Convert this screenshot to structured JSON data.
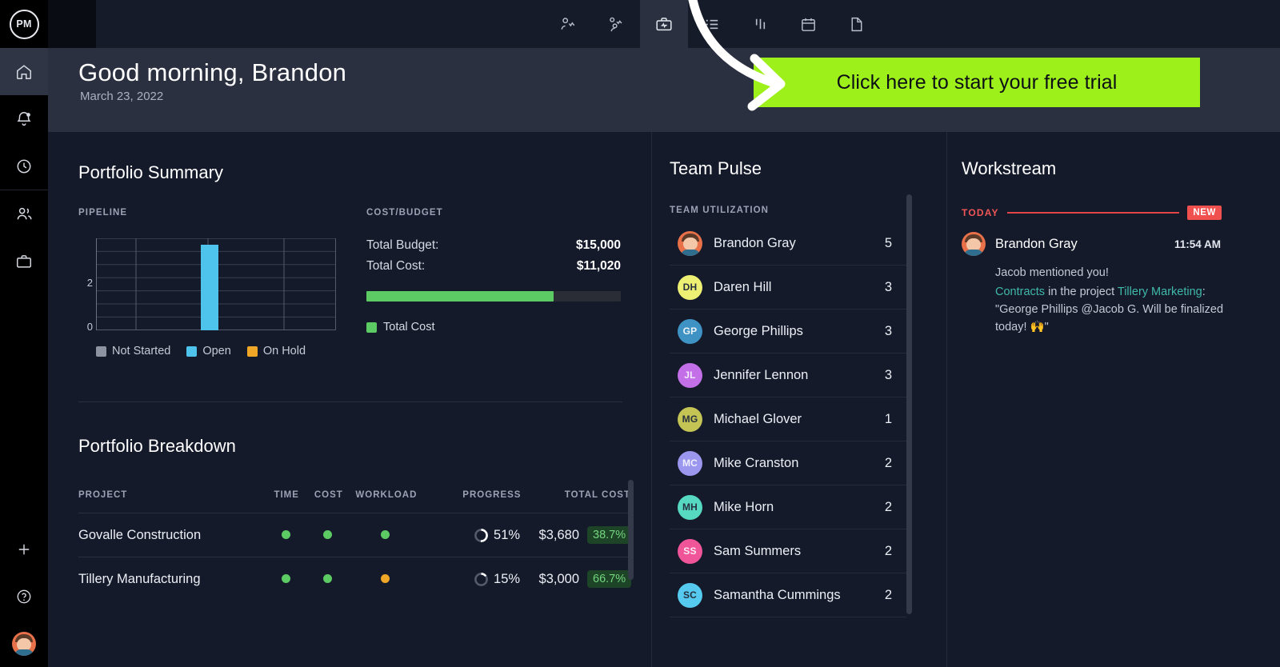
{
  "brand": {
    "logo_text": "PM"
  },
  "sidebar": {
    "items": [
      {
        "name": "home",
        "icon": "home-icon",
        "active": true
      },
      {
        "name": "notifications",
        "icon": "bell-icon",
        "active": false
      },
      {
        "name": "timesheets",
        "icon": "clock-icon",
        "active": false
      },
      {
        "name": "team",
        "icon": "people-icon",
        "active": false
      },
      {
        "name": "projects",
        "icon": "briefcase-icon",
        "active": false
      }
    ],
    "bottom_items": [
      {
        "name": "add",
        "icon": "plus-icon"
      },
      {
        "name": "help",
        "icon": "question-circle-icon"
      },
      {
        "name": "profile",
        "icon": "user-avatar"
      }
    ]
  },
  "topbar": {
    "tabs": [
      {
        "name": "my-work",
        "icon": "person-chart-icon",
        "active": false
      },
      {
        "name": "team-chart",
        "icon": "people-chart-icon",
        "active": false
      },
      {
        "name": "portfolio",
        "icon": "briefcase-chart-icon",
        "active": true
      },
      {
        "name": "list",
        "icon": "list-icon",
        "active": false
      },
      {
        "name": "gantt",
        "icon": "gantt-icon",
        "active": false
      },
      {
        "name": "calendar",
        "icon": "calendar-icon",
        "active": false
      },
      {
        "name": "docs",
        "icon": "document-icon",
        "active": false
      }
    ]
  },
  "greeting": {
    "title": "Good morning, Brandon",
    "date": "March 23, 2022"
  },
  "cta": {
    "label": "Click here to start your free trial",
    "color": "#9ef01a",
    "arrow": "curved-arrow-icon"
  },
  "portfolio_summary": {
    "title": "Portfolio Summary",
    "pipeline_label": "PIPELINE",
    "cost_budget_label": "COST/BUDGET",
    "total_budget_label": "Total Budget:",
    "total_budget_value": "$15,000",
    "total_cost_label": "Total Cost:",
    "total_cost_value": "$11,020",
    "cost_legend": "Total Cost",
    "cost_fill_percent": 73.5,
    "legend": [
      {
        "label": "Not Started",
        "color": "#8d93a1"
      },
      {
        "label": "Open",
        "color": "#4ec3ec"
      },
      {
        "label": "On Hold",
        "color": "#f0a626"
      }
    ]
  },
  "chart_data": {
    "type": "bar",
    "title": "PIPELINE",
    "categories": [
      "Not Started",
      "Open",
      "On Hold",
      ""
    ],
    "series": [
      {
        "name": "Not Started",
        "values": [
          0,
          0,
          0,
          0
        ],
        "color": "#8d93a1"
      },
      {
        "name": "Open",
        "values": [
          0,
          0,
          3,
          0
        ],
        "color": "#4ec3ec"
      },
      {
        "name": "On Hold",
        "values": [
          0,
          0,
          0,
          0
        ],
        "color": "#f0a626"
      }
    ],
    "values": [
      0,
      0,
      3,
      0
    ],
    "xlabel": "",
    "ylabel": "",
    "ylim": [
      0,
      3.5
    ],
    "yticks": [
      0,
      2
    ],
    "ytick_labels": [
      "0",
      "2"
    ],
    "grid": true,
    "legend_position": "bottom"
  },
  "portfolio_breakdown": {
    "title": "Portfolio Breakdown",
    "columns": [
      "PROJECT",
      "TIME",
      "COST",
      "WORKLOAD",
      "PROGRESS",
      "TOTAL COST"
    ],
    "rows": [
      {
        "project": "Govalle Construction",
        "time": "green",
        "cost": "green",
        "workload": "green",
        "progress": "51%",
        "progress_value": 51,
        "total_cost": "$3,680",
        "pct": "38.7%"
      },
      {
        "project": "Tillery Manufacturing",
        "time": "green",
        "cost": "green",
        "workload": "orange",
        "progress": "15%",
        "progress_value": 15,
        "total_cost": "$3,000",
        "pct": "66.7%"
      }
    ],
    "status_colors": {
      "green": "#5ccb63",
      "orange": "#f0a626"
    }
  },
  "team_pulse": {
    "title": "Team Pulse",
    "section_label": "TEAM UTILIZATION",
    "members": [
      {
        "name": "Brandon Gray",
        "initials": "",
        "value": "5",
        "color": "#e8714a",
        "is_photo": true
      },
      {
        "name": "Daren Hill",
        "initials": "DH",
        "value": "3",
        "color": "#eef073"
      },
      {
        "name": "George Phillips",
        "initials": "GP",
        "value": "3",
        "color": "#3f93c4"
      },
      {
        "name": "Jennifer Lennon",
        "initials": "JL",
        "value": "3",
        "color": "#c36fe8"
      },
      {
        "name": "Michael Glover",
        "initials": "MG",
        "value": "1",
        "color": "#c4c454"
      },
      {
        "name": "Mike Cranston",
        "initials": "MC",
        "value": "2",
        "color": "#9b96ee"
      },
      {
        "name": "Mike Horn",
        "initials": "MH",
        "value": "2",
        "color": "#56d9c0"
      },
      {
        "name": "Sam Summers",
        "initials": "SS",
        "value": "2",
        "color": "#f0559a"
      },
      {
        "name": "Samantha Cummings",
        "initials": "SC",
        "value": "2",
        "color": "#56c9ee"
      }
    ]
  },
  "workstream": {
    "title": "Workstream",
    "today_label": "TODAY",
    "new_badge": "NEW",
    "item": {
      "author": "Brandon Gray",
      "time": "11:54 AM",
      "headline": "Jacob mentioned you!",
      "link_1": "Contracts",
      "mid_text": " in the project ",
      "link_2": "Tillery Marketing",
      "tail_text": ": \"George Phillips @Jacob G. Will be finalized today! 🙌\""
    }
  }
}
